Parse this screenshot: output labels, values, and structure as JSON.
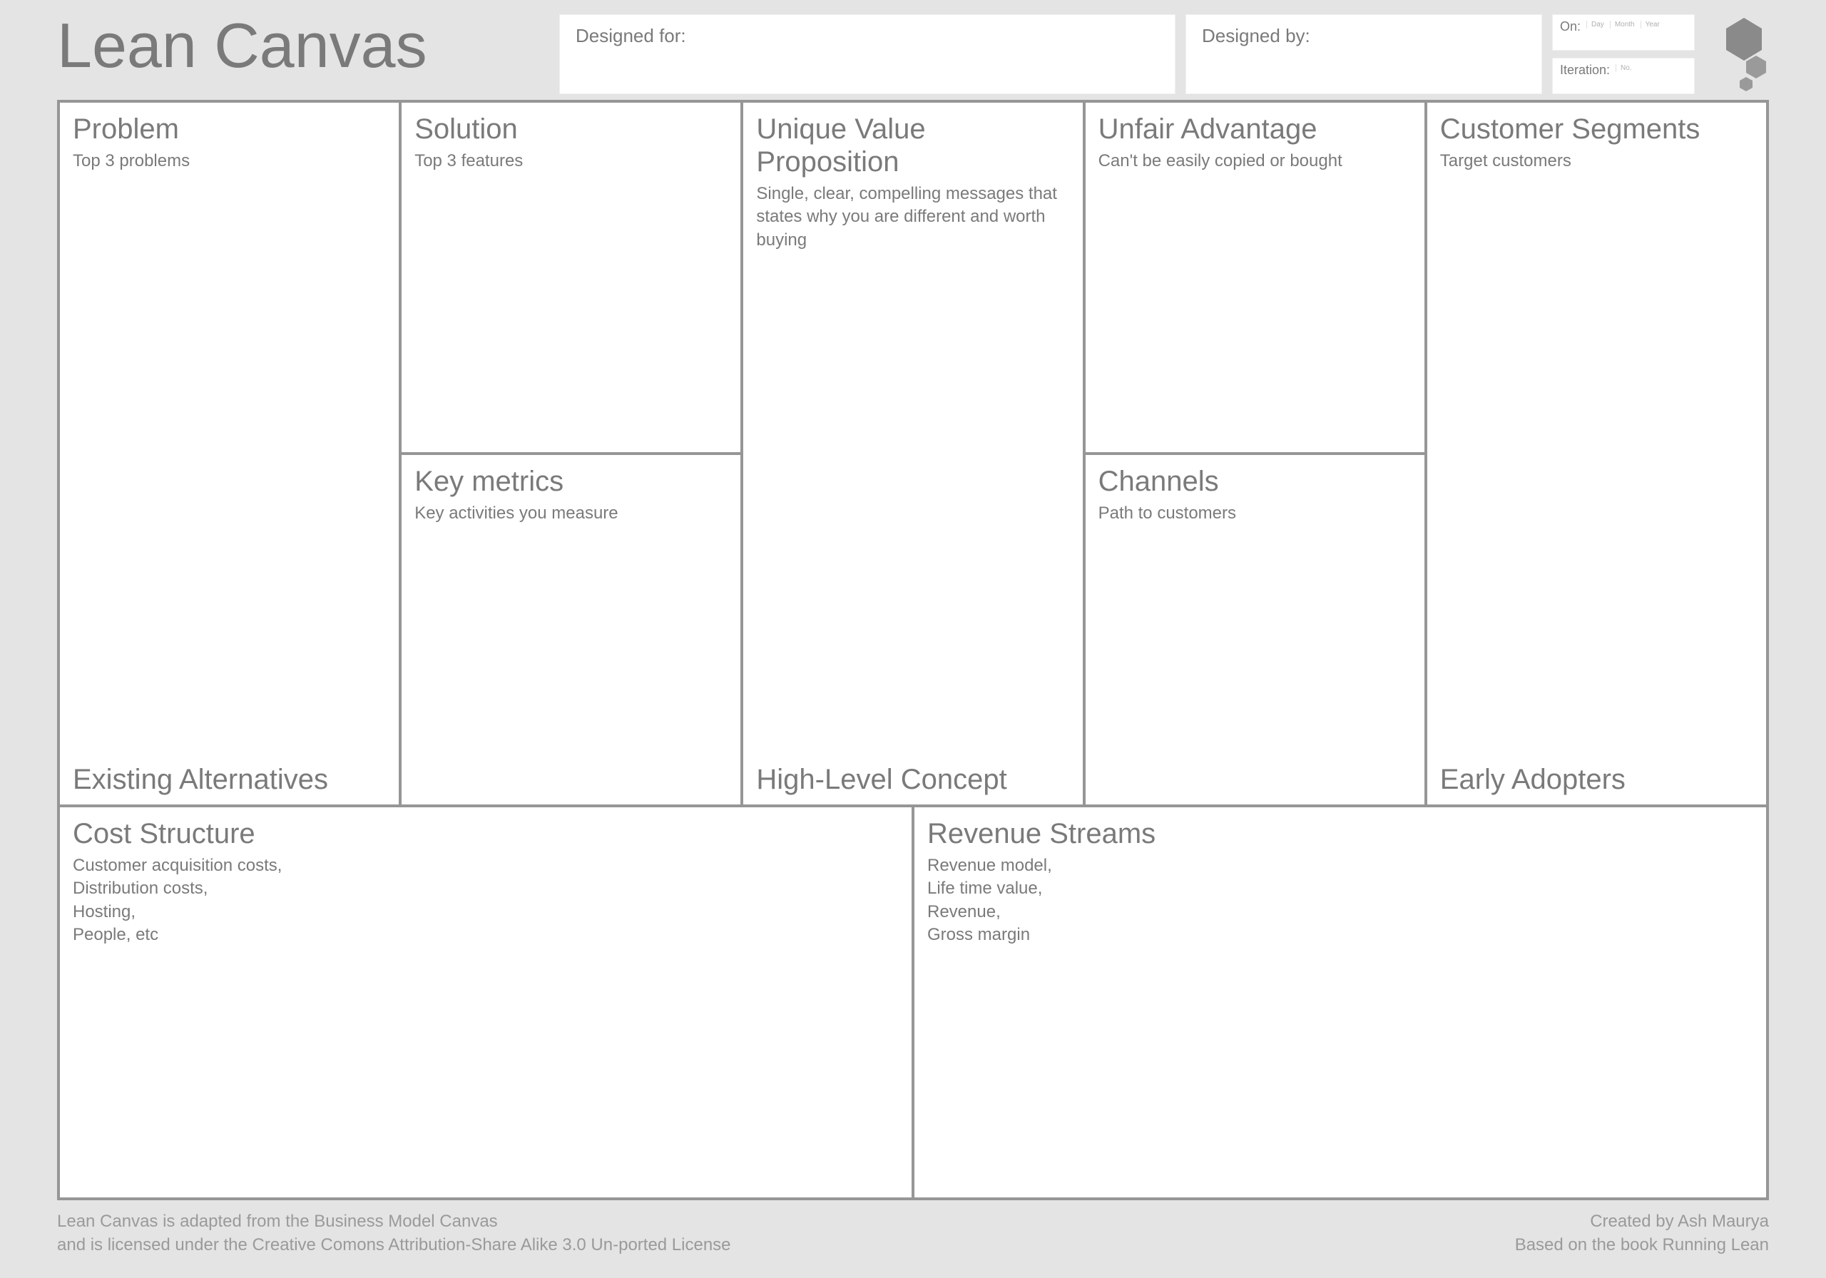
{
  "header": {
    "title": "Lean Canvas",
    "designed_for_label": "Designed for:",
    "designed_by_label": "Designed by:",
    "on_label": "On:",
    "on_sub_day": "Day",
    "on_sub_month": "Month",
    "on_sub_year": "Year",
    "iteration_label": "Iteration:",
    "iteration_sub": "No."
  },
  "cells": {
    "problem": {
      "title": "Problem",
      "sub": "Top 3 problems",
      "secondary": "Existing Alternatives"
    },
    "solution": {
      "title": "Solution",
      "sub": "Top 3 features"
    },
    "keymetrics": {
      "title": "Key metrics",
      "sub": "Key activities you measure"
    },
    "uvp": {
      "title": "Unique Value Proposition",
      "sub": "Single, clear, compelling messages that states why you are different and worth buying",
      "secondary": "High-Level Concept"
    },
    "unfair": {
      "title": "Unfair Advantage",
      "sub": "Can't be easily copied or bought"
    },
    "channels": {
      "title": "Channels",
      "sub": "Path to customers"
    },
    "customers": {
      "title": "Customer Segments",
      "sub": "Target customers",
      "secondary": "Early Adopters"
    },
    "cost": {
      "title": "Cost Structure",
      "sub": "Customer acquisition costs,\nDistribution costs,\nHosting,\nPeople, etc"
    },
    "revenue": {
      "title": "Revenue Streams",
      "sub": "Revenue model,\nLife time value,\nRevenue,\nGross margin"
    }
  },
  "footer": {
    "left_line1": "Lean Canvas is adapted from the Business Model Canvas",
    "left_line2": "and is licensed under the Creative Comons Attribution-Share Alike 3.0 Un-ported License",
    "right_line1": "Created by Ash Maurya",
    "right_line2": "Based on the book Running Lean"
  }
}
